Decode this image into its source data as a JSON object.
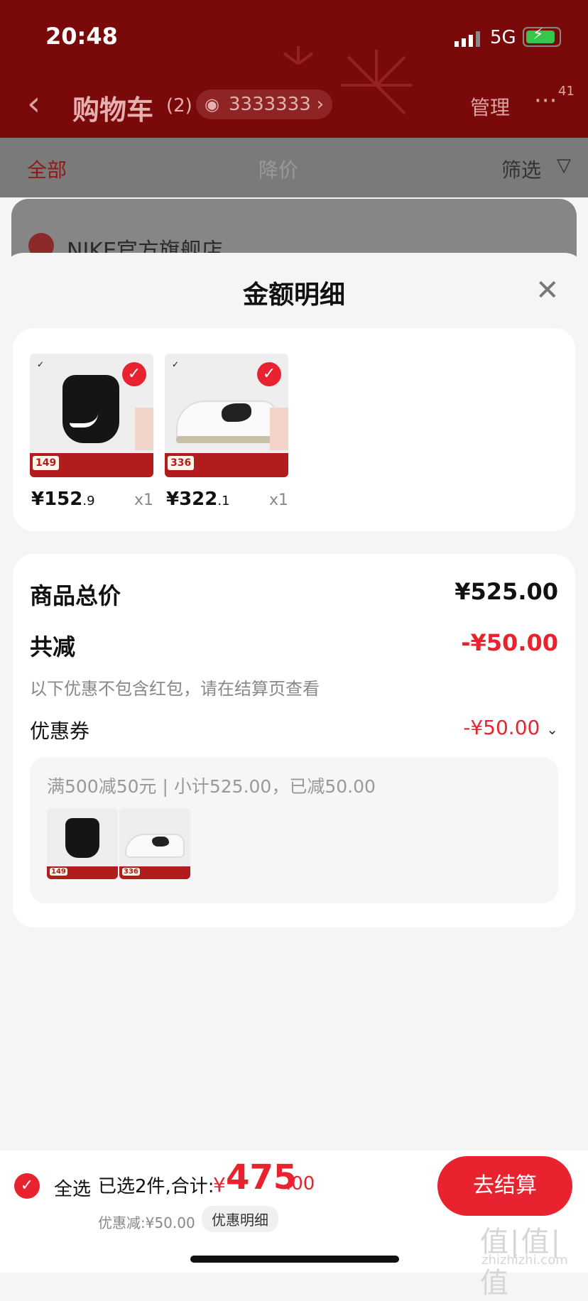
{
  "status_bar": {
    "time": "20:48",
    "network": "5G"
  },
  "nav": {
    "title": "购物车",
    "count": "(2)",
    "views": "3333333",
    "manage": "管理",
    "more_badge": "41"
  },
  "filters": {
    "tab_all": "全部",
    "tab_price_drop": "降价",
    "filter": "筛选"
  },
  "store": {
    "name": "NIKE官方旗舰店"
  },
  "sheet": {
    "title": "金额明细",
    "items": [
      {
        "price_main": "¥152",
        "price_dec": ".9",
        "qty": "x1",
        "tag": "149"
      },
      {
        "price_main": "¥322",
        "price_dec": ".1",
        "qty": "x1",
        "tag": "336"
      }
    ],
    "summary": {
      "total_label": "商品总价",
      "total_value": "¥525.00",
      "discount_label": "共减",
      "discount_value": "-¥50.00",
      "note": "以下优惠不包含红包，请在结算页查看",
      "coupon_label": "优惠券",
      "coupon_value": "-¥50.00",
      "coupon_desc": "满500减50元 | 小计525.00，已减50.00"
    }
  },
  "bottom": {
    "select_all": "全选",
    "selected": "已选2件,合计:",
    "currency": "¥",
    "total_int": "475",
    "total_dec": ".00",
    "discount": "优惠减:¥50.00",
    "detail": "优惠明细",
    "checkout": "去结算"
  },
  "watermark": {
    "main": "值|值|值",
    "sub": "zhizhizhi.com"
  },
  "colors": {
    "accent": "#e8232f",
    "header": "#7a0a0a"
  }
}
